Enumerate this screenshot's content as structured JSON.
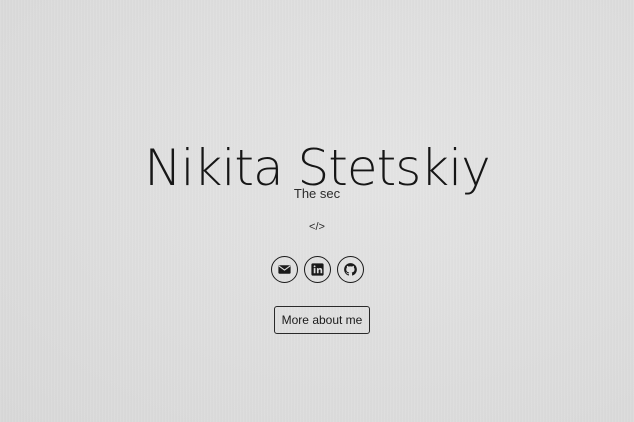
{
  "hero": {
    "name": "Nikita Stetskiy",
    "tagline": "The sec",
    "code_glyph": "</>",
    "more_button_label": "More about me"
  },
  "socials": [
    {
      "icon": "mail-icon"
    },
    {
      "icon": "linkedin-icon"
    },
    {
      "icon": "github-icon"
    }
  ],
  "colors": {
    "background": "#dcdcdc",
    "text": "#1a1a1a"
  }
}
